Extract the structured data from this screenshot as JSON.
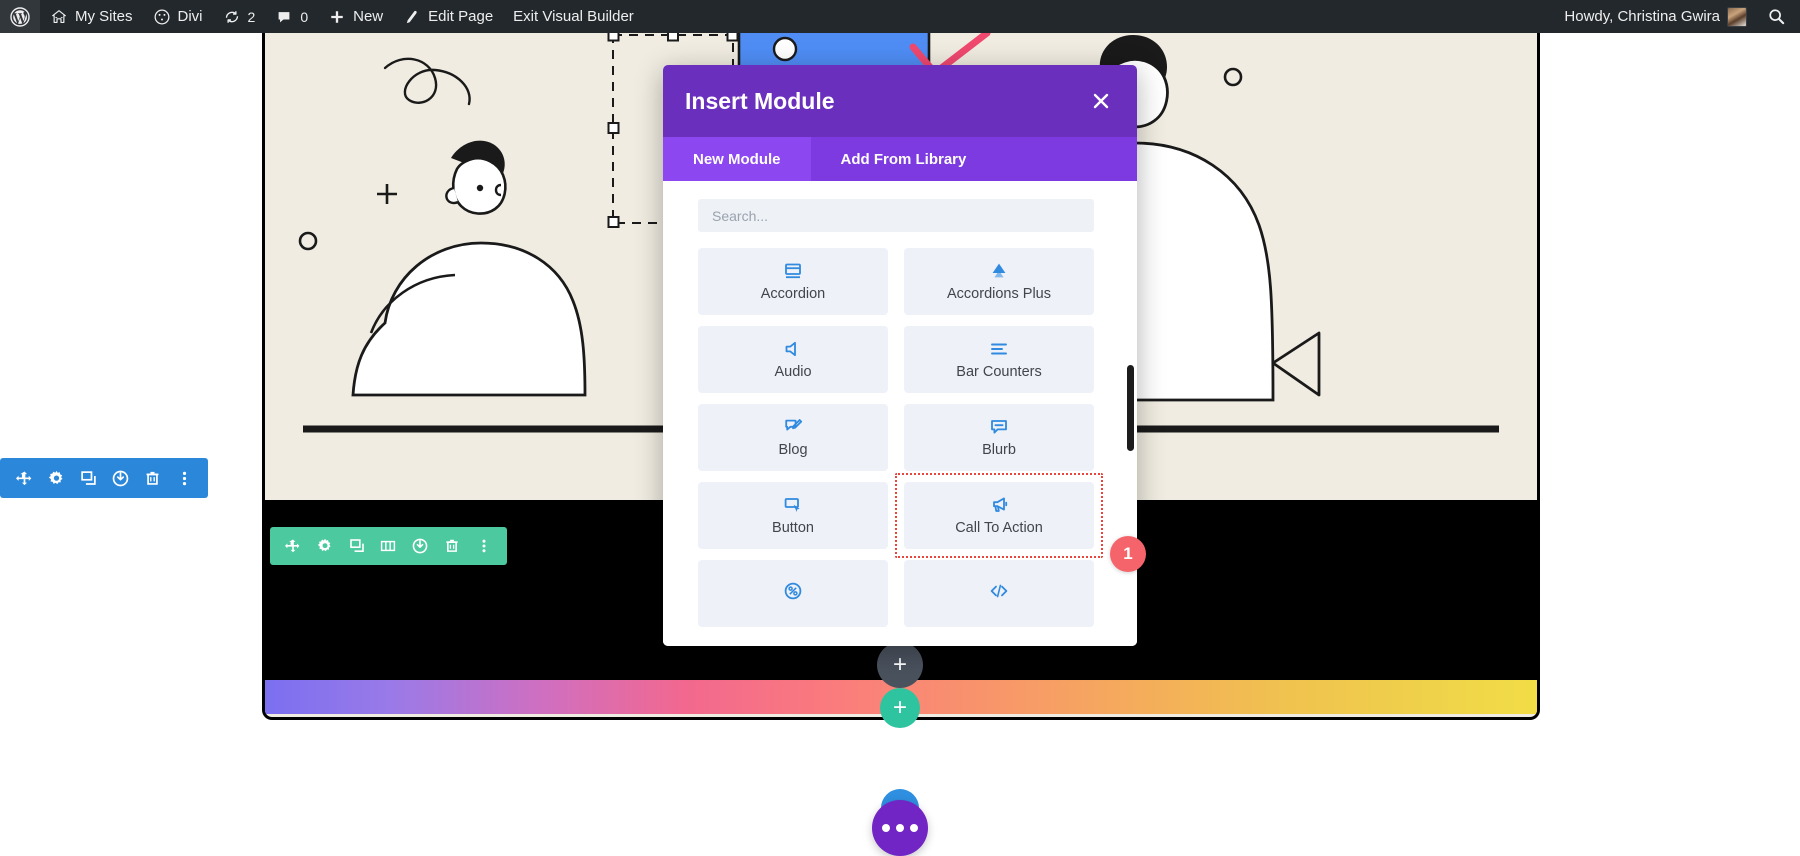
{
  "adminbar": {
    "wp_logo": "wordpress-logo-icon",
    "items": [
      {
        "label": "My Sites",
        "icon": "sites-icon"
      },
      {
        "label": "Divi",
        "icon": "divi-icon"
      },
      {
        "label": "2",
        "icon": "updates-icon"
      },
      {
        "label": "0",
        "icon": "comments-icon"
      },
      {
        "label": "New",
        "icon": "plus-icon"
      },
      {
        "label": "Edit Page",
        "icon": "pencil-icon"
      },
      {
        "label": "Exit Visual Builder",
        "icon": ""
      }
    ],
    "howdy": "Howdy, Christina Gwira",
    "avatar": "user-avatar",
    "search_icon": "search-icon"
  },
  "modal": {
    "title": "Insert Module",
    "close_icon": "close-icon",
    "tabs": [
      {
        "label": "New Module",
        "active": true
      },
      {
        "label": "Add From Library",
        "active": false
      }
    ],
    "search": {
      "value": "",
      "placeholder": "Search..."
    },
    "modules": [
      {
        "label": "Accordion",
        "icon": "accordion-icon",
        "highlight": false
      },
      {
        "label": "Accordions Plus",
        "icon": "accordions-plus-icon",
        "highlight": false
      },
      {
        "label": "Audio",
        "icon": "audio-icon",
        "highlight": false
      },
      {
        "label": "Bar Counters",
        "icon": "bar-counters-icon",
        "highlight": false
      },
      {
        "label": "Blog",
        "icon": "blog-icon",
        "highlight": false
      },
      {
        "label": "Blurb",
        "icon": "blurb-icon",
        "highlight": false
      },
      {
        "label": "Button",
        "icon": "button-icon",
        "highlight": false
      },
      {
        "label": "Call To Action",
        "icon": "call-to-action-icon",
        "highlight": true
      },
      {
        "label": "",
        "icon": "circle-counter-icon",
        "highlight": false
      },
      {
        "label": "",
        "icon": "code-icon",
        "highlight": false
      }
    ],
    "badge": "1"
  },
  "section_toolbar": {
    "color": "#2b87da",
    "buttons": [
      {
        "name": "move-handle",
        "icon": "move-icon"
      },
      {
        "name": "settings-button",
        "icon": "gear-icon"
      },
      {
        "name": "duplicate-button",
        "icon": "duplicate-icon"
      },
      {
        "name": "disable-button",
        "icon": "power-icon"
      },
      {
        "name": "delete-button",
        "icon": "trash-icon"
      },
      {
        "name": "more-options-button",
        "icon": "kebab-icon"
      }
    ]
  },
  "row_toolbar": {
    "color": "#4dc9a0",
    "buttons": [
      {
        "name": "move-handle",
        "icon": "move-icon"
      },
      {
        "name": "settings-button",
        "icon": "gear-icon"
      },
      {
        "name": "duplicate-button",
        "icon": "duplicate-icon"
      },
      {
        "name": "column-structure-button",
        "icon": "columns-icon"
      },
      {
        "name": "disable-button",
        "icon": "power-icon"
      },
      {
        "name": "delete-button",
        "icon": "trash-icon"
      },
      {
        "name": "more-options-button",
        "icon": "kebab-icon"
      }
    ]
  },
  "add_buttons": {
    "add_module": "+",
    "add_row": "+"
  },
  "fab": {
    "icon": "ellipsis-icon",
    "color": "#7025c4"
  }
}
